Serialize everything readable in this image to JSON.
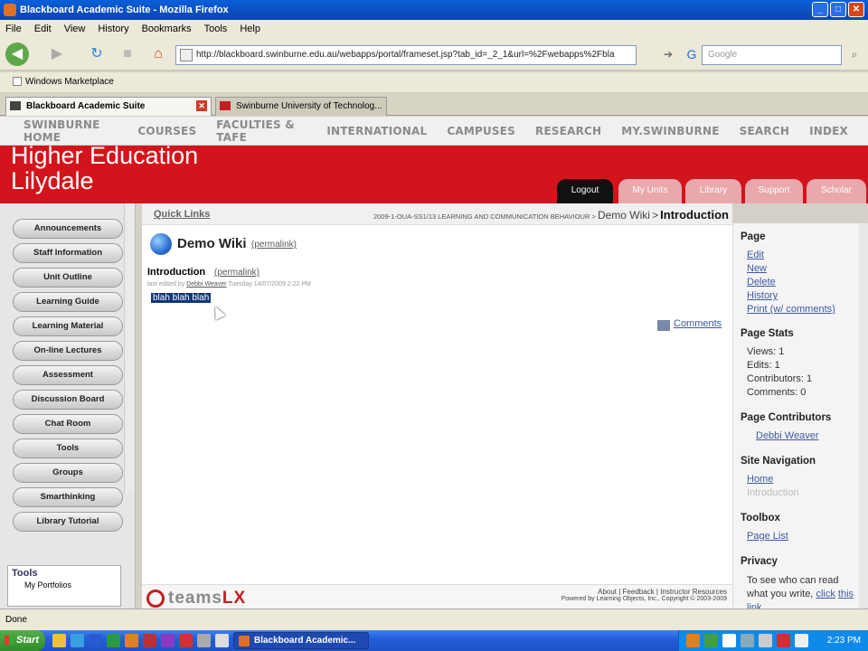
{
  "window": {
    "title": "Blackboard Academic Suite - Mozilla Firefox"
  },
  "menu": [
    "File",
    "Edit",
    "View",
    "History",
    "Bookmarks",
    "Tools",
    "Help"
  ],
  "nav": {
    "url": "http://blackboard.swinburne.edu.au/webapps/portal/frameset.jsp?tab_id=_2_1&url=%2Fwebapps%2Fbla",
    "search_placeholder": "Google"
  },
  "bookmarks": [
    "Windows Marketplace"
  ],
  "tabs": [
    {
      "label": "Blackboard Academic Suite"
    },
    {
      "label": "Swinburne University of Technolog..."
    }
  ],
  "site_nav": [
    "SWINBURNE HOME",
    "COURSES",
    "FACULTIES & TAFE",
    "INTERNATIONAL",
    "CAMPUSES",
    "RESEARCH",
    "MY.SWINBURNE",
    "SEARCH",
    "INDEX"
  ],
  "banner": {
    "line1": "Higher Education",
    "line2": "Lilydale",
    "tabs": [
      "Logout",
      "My Units",
      "Library",
      "Support",
      "Scholar"
    ]
  },
  "left_menu": [
    "Announcements",
    "Staff Information",
    "Unit Outline",
    "Learning Guide",
    "Learning Material",
    "On-line Lectures",
    "Assessment",
    "Discussion Board",
    "Chat Room",
    "Tools",
    "Groups",
    "Smarthinking",
    "Library Tutorial"
  ],
  "left_tools": {
    "heading": "Tools",
    "item": "My Portfolios"
  },
  "breadcrumb": {
    "quick_links": "Quick Links",
    "unit": "2009-1-OUA-SS1/13 LEARNING AND COMMUNICATION BEHAVIOUR",
    "sep": ">",
    "wiki": "Demo Wiki",
    "current": "Introduction"
  },
  "content": {
    "wiki_title": "Demo Wiki",
    "permalink": "(permalink)",
    "page_title": "Introduction",
    "last_edit_prefix": "last edited by",
    "last_edit_user": "Debbi Weaver",
    "last_edit_date": "Tuesday 14/07/2009 2:22 PM",
    "body_text": "blah blah blah",
    "comments": "Comments"
  },
  "footer": {
    "logo_text": "teams",
    "logo_lx": "LX",
    "links": "About  | Feedback | Instructor Resources",
    "powered": "Powered by Learning Objects, Inc., Copyright © 2003-2009"
  },
  "right_panel": {
    "page_heading": "Page",
    "page_links": [
      "Edit",
      "New",
      "Delete",
      "History",
      "Print (w/ comments)"
    ],
    "stats_heading": "Page Stats",
    "stats": [
      "Views: 1",
      "Edits: 1",
      "Contributors: 1",
      "Comments: 0"
    ],
    "contributors_heading": "Page Contributors",
    "contributor": "Debbi Weaver",
    "site_nav_heading": "Site Navigation",
    "site_nav": [
      "Home",
      "Introduction"
    ],
    "toolbox_heading": "Toolbox",
    "toolbox_item": "Page List",
    "privacy_heading": "Privacy",
    "privacy_text": "To see who can read what you write,",
    "privacy_link": "click",
    "privacy_link2": "this link"
  },
  "status": "Done",
  "taskbar": {
    "start": "Start",
    "item": "Blackboard Academic...",
    "clock": "2:23 PM"
  },
  "colors": {
    "banner_red": "#d4141c",
    "link_blue": "#3d5aa0",
    "selection": "#12367a"
  }
}
